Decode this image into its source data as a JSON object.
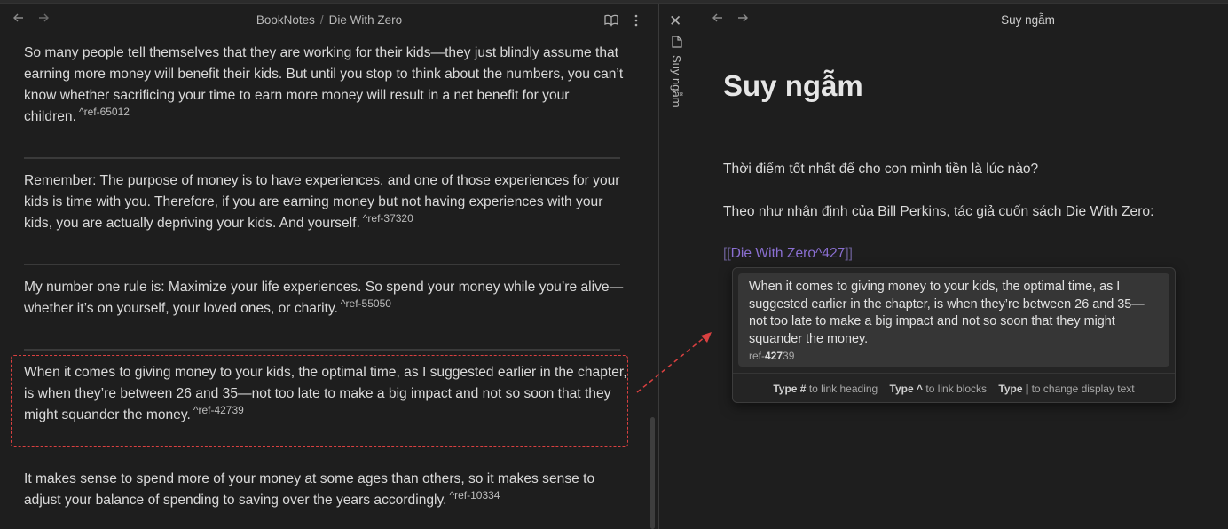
{
  "left": {
    "breadcrumb_folder": "BookNotes",
    "breadcrumb_sep": "/",
    "breadcrumb_file": "Die With Zero",
    "blocks": [
      {
        "text": "So many people tell themselves that they are working for their kids—they just blindly assume that earning more money will benefit their kids. But until you stop to think about the numbers, you can’t know whether sacrificing your time to earn more money will result in a net benefit for your children.",
        "ref": "^ref-65012"
      },
      {
        "text": "Remember: The purpose of money is to have experiences, and one of those experiences for your kids is time with you. Therefore, if you are earning money but not having experiences with your kids, you are actually depriving your kids. And yourself.",
        "ref": "^ref-37320"
      },
      {
        "text": "My number one rule is: Maximize your life experiences. So spend your money while you’re alive—whether it’s on yourself, your loved ones, or charity.",
        "ref": "^ref-55050"
      },
      {
        "text": "When it comes to giving money to your kids, the optimal time, as I suggested earlier in the chapter, is when they’re between 26 and 35—not too late to make a big impact and not so soon that they might squander the money.",
        "ref": "^ref-42739"
      },
      {
        "text": "It makes sense to spend more of your money at some ages than others, so it makes sense to adjust your balance of spending to saving over the years accordingly.",
        "ref": "^ref-10334"
      }
    ]
  },
  "side": {
    "vertical_title": "Suy ngẫm"
  },
  "right": {
    "tab_title": "Suy ngẫm",
    "note_title": "Suy ngẫm",
    "para1": "Thời điểm tốt nhất để cho con mình tiền là lúc nào?",
    "para2": "Theo như nhận định của Bill Perkins, tác giả cuốn sách Die With Zero:",
    "link_open": "[[",
    "link_text": "Die With Zero^427",
    "link_close": "]]",
    "popup": {
      "suggestion_text": "When it comes to giving money to your kids, the optimal time, as I suggested earlier in the chapter, is when they’re between 26 and 35—not too late to make a big impact and not so soon that they might squander the money.",
      "ref_prefix": "ref-",
      "ref_match": "427",
      "ref_suffix": "39",
      "hint1_key": "Type #",
      "hint1_text": "to link heading",
      "hint2_key": "Type ^",
      "hint2_text": "to link blocks",
      "hint3_key": "Type |",
      "hint3_text": "to change display text"
    }
  },
  "colors": {
    "background": "#1e1e1e",
    "link": "#8a6fd1",
    "annotation": "#d94040"
  }
}
